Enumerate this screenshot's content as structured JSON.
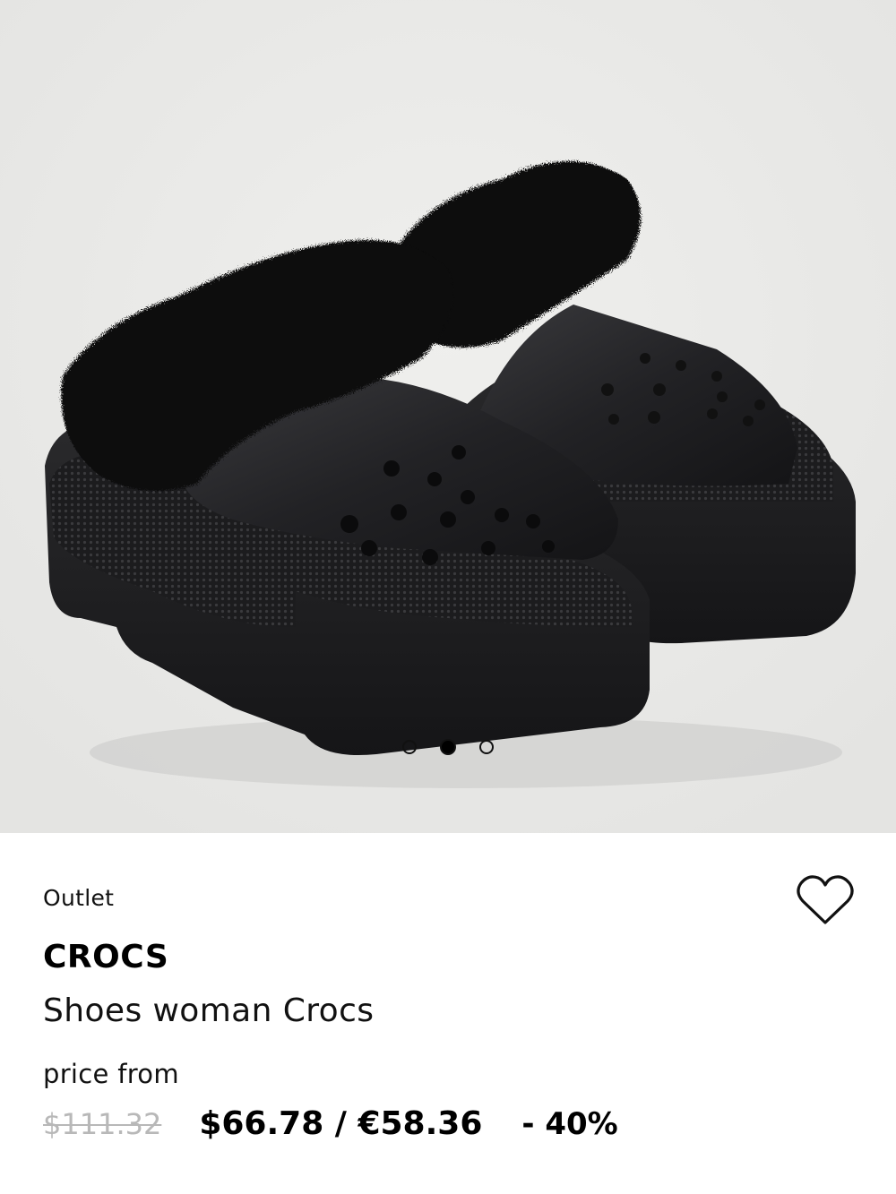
{
  "product": {
    "label": "Outlet",
    "brand": "CROCS",
    "name": "Shoes woman Crocs",
    "price_prefix": "price from",
    "original_price": "$111.32",
    "sale_price": "$66.78 / €58.36",
    "discount": "- 40%"
  },
  "gallery": {
    "image_count": 3,
    "active_index": 1
  },
  "icons": {
    "wishlist": "heart-outline-icon"
  },
  "colors": {
    "text": "#000000",
    "muted_price": "#b8b8b8",
    "background": "#ffffff"
  }
}
